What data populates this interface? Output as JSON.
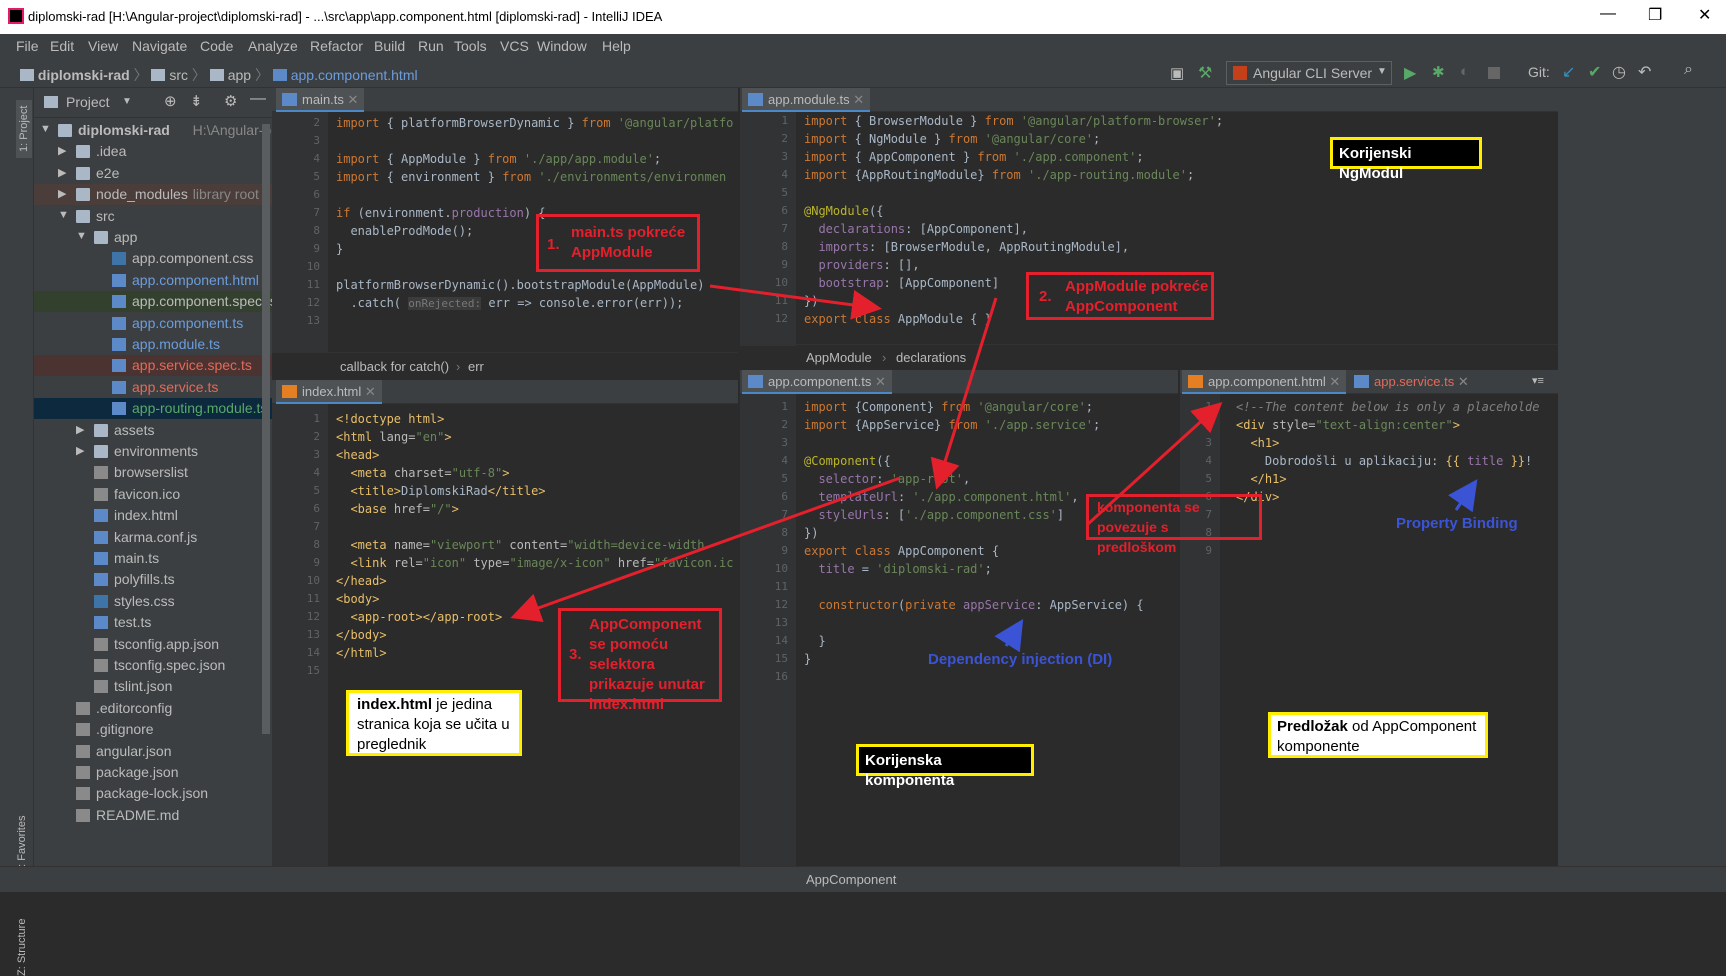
{
  "window": {
    "title": "diplomski-rad [H:\\Angular-project\\diplomski-rad] - ...\\src\\app\\app.component.html [diplomski-rad] - IntelliJ IDEA"
  },
  "menu": [
    "File",
    "Edit",
    "View",
    "Navigate",
    "Code",
    "Analyze",
    "Refactor",
    "Build",
    "Run",
    "Tools",
    "VCS",
    "Window",
    "Help"
  ],
  "breadcrumbs": [
    "diplomski-rad",
    "src",
    "app",
    "app.component.html"
  ],
  "toolbar": {
    "run_config": "Angular CLI Server",
    "git_label": "Git:"
  },
  "leftstrip": {
    "project": "1: Project",
    "favorites": "2: Favorites",
    "structure": "Z: Structure"
  },
  "project": {
    "header": "Project",
    "root": "diplomski-rad",
    "root_path": "H:\\Angular-project\\d",
    "items": [
      {
        "label": "diplomski-rad",
        "hint": "H:\\Angular-project\\d"
      },
      {
        "label": ".idea",
        "hint": ""
      },
      {
        "label": "e2e",
        "hint": ""
      },
      {
        "label": "node_modules",
        "hint": "library root"
      },
      {
        "label": "src",
        "hint": ""
      },
      {
        "label": "app",
        "hint": ""
      },
      {
        "label": "app.component.css",
        "hint": ""
      },
      {
        "label": "app.component.html",
        "hint": ""
      },
      {
        "label": "app.component.spec.ts",
        "hint": ""
      },
      {
        "label": "app.component.ts",
        "hint": ""
      },
      {
        "label": "app.module.ts",
        "hint": ""
      },
      {
        "label": "app.service.spec.ts",
        "hint": ""
      },
      {
        "label": "app.service.ts",
        "hint": ""
      },
      {
        "label": "app-routing.module.ts",
        "hint": ""
      },
      {
        "label": "assets",
        "hint": ""
      },
      {
        "label": "environments",
        "hint": ""
      },
      {
        "label": "browserslist",
        "hint": ""
      },
      {
        "label": "favicon.ico",
        "hint": ""
      },
      {
        "label": "index.html",
        "hint": ""
      },
      {
        "label": "karma.conf.js",
        "hint": ""
      },
      {
        "label": "main.ts",
        "hint": ""
      },
      {
        "label": "polyfills.ts",
        "hint": ""
      },
      {
        "label": "styles.css",
        "hint": ""
      },
      {
        "label": "test.ts",
        "hint": ""
      },
      {
        "label": "tsconfig.app.json",
        "hint": ""
      },
      {
        "label": "tsconfig.spec.json",
        "hint": ""
      },
      {
        "label": "tslint.json",
        "hint": ""
      },
      {
        "label": ".editorconfig",
        "hint": ""
      },
      {
        "label": ".gitignore",
        "hint": ""
      },
      {
        "label": "angular.json",
        "hint": ""
      },
      {
        "label": "package.json",
        "hint": ""
      },
      {
        "label": "package-lock.json",
        "hint": ""
      },
      {
        "label": "README.md",
        "hint": ""
      }
    ]
  },
  "editors": {
    "main_ts": {
      "tab": "main.ts",
      "breadcrumb_a": "callback for catch()",
      "breadcrumb_b": "err",
      "lines": [
        "2",
        "3",
        "4",
        "5",
        "6",
        "7",
        "8",
        "9",
        "10",
        "11",
        "12",
        "13"
      ]
    },
    "app_module": {
      "tab": "app.module.ts",
      "breadcrumb_a": "AppModule",
      "breadcrumb_b": "declarations",
      "lines": [
        "1",
        "2",
        "3",
        "4",
        "5",
        "6",
        "7",
        "8",
        "9",
        "10",
        "11",
        "12"
      ]
    },
    "index_html": {
      "tab": "index.html",
      "lines": [
        "1",
        "2",
        "3",
        "4",
        "5",
        "6",
        "7",
        "8",
        "9",
        "10",
        "11",
        "12",
        "13",
        "14",
        "15"
      ]
    },
    "app_component": {
      "tab": "app.component.ts",
      "breadcrumb": "AppComponent",
      "lines": [
        "1",
        "2",
        "3",
        "4",
        "5",
        "6",
        "7",
        "8",
        "9",
        "10",
        "11",
        "12",
        "13",
        "14",
        "15",
        "16"
      ]
    },
    "component_html": {
      "tab": "app.component.html",
      "tab2": "app.service.ts",
      "lines": [
        "1",
        "2",
        "3",
        "4",
        "5",
        "6",
        "7",
        "8",
        "9"
      ]
    }
  },
  "annotations": {
    "a1": "1.",
    "a1_text": "main.ts pokreće AppModule",
    "a2": "2.",
    "a2_text": "AppModule pokreće AppComponent",
    "a3": "3.",
    "a3_text": "AppComponent se pomoću selektora prikazuje unutar index.html",
    "link": "komponenta se povezuje s predloškom",
    "root_module": "Korijenski NgModul",
    "root_component": "Korijenska komponenta",
    "index_note_bold": "index.html",
    "index_note": " je jedina stranica koja se učita u preglednik",
    "template_note_bold": "Predložak",
    "template_note": " od AppComponent komponente",
    "di": "Dependency injection (DI)",
    "pb": "Property Binding"
  }
}
